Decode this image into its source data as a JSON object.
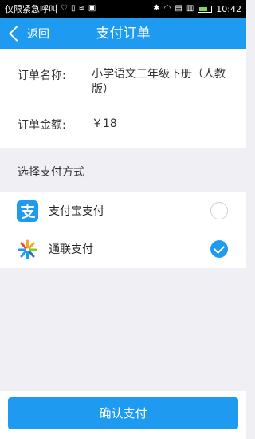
{
  "status_bar": {
    "carrier": "仅限紧急呼叫",
    "time": "10:42",
    "battery_level": 0.7,
    "icons": [
      "shield-icon",
      "sim-icon",
      "signal-icon",
      "image-icon",
      "bluetooth-icon",
      "wifi-icon",
      "sim-card-icon",
      "phone-icon",
      "battery-icon"
    ]
  },
  "nav": {
    "back_label": "返回",
    "title": "支付订单",
    "color": "#1e9bf0"
  },
  "order": {
    "name_label": "订单名称:",
    "name_value": "小学语文三年级下册（人教版）",
    "amount_label": "订单金额:",
    "amount_value": "￥18"
  },
  "payment": {
    "section_title": "选择支付方式",
    "methods": [
      {
        "label": "支付宝支付",
        "icon": "alipay-icon",
        "selected": false
      },
      {
        "label": "通联支付",
        "icon": "allinpay-icon",
        "selected": true
      }
    ]
  },
  "footer": {
    "confirm_label": "确认支付"
  }
}
